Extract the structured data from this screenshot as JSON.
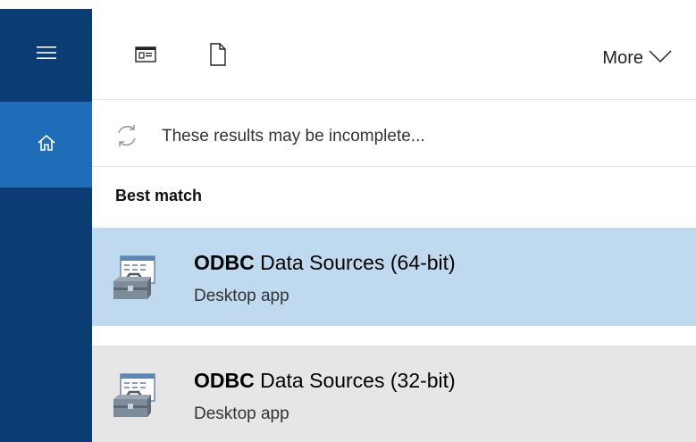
{
  "toolbar": {
    "more_label": "More"
  },
  "notice": {
    "text": "These results may be incomplete..."
  },
  "best_match": {
    "heading": "Best match"
  },
  "results": [
    {
      "highlight": "ODBC",
      "rest": " Data Sources (64-bit)",
      "subtitle": "Desktop app"
    },
    {
      "highlight": "ODBC",
      "rest": " Data Sources (32-bit)",
      "subtitle": "Desktop app"
    }
  ],
  "colors": {
    "sidebar": "#0b3d74",
    "sidebar_active": "#1f6db8",
    "selected_result": "#bfd9ef",
    "hover_result": "#e6e6e6"
  },
  "icons": {
    "menu": "hamburger-icon",
    "home": "home-icon",
    "apps_filter": "app-window-icon",
    "documents_filter": "document-icon",
    "more": "chevron-down-icon",
    "loading": "sync-icon",
    "result_app": "toolbox-app-icon"
  }
}
